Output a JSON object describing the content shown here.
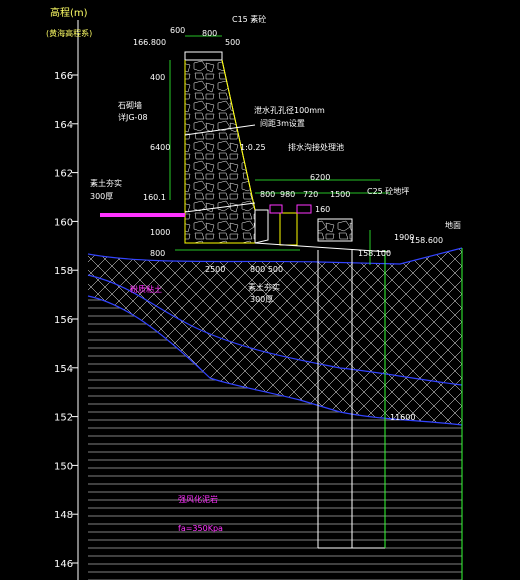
{
  "axis": {
    "title": "高程(m)",
    "subtitle": "(黄海高程系)",
    "ticks": [
      "166",
      "164",
      "162",
      "160",
      "158",
      "156",
      "154",
      "152",
      "150",
      "148",
      "146"
    ]
  },
  "labels": {
    "top_elev": "166.800",
    "c15": "C15 素砼",
    "dim_600": "600",
    "dim_800": "800",
    "dim_500": "500",
    "dim_400": "400",
    "dim_6400": "6400",
    "ret_wall": "石砌墙",
    "ret_wall_sub": "详JG-08",
    "drain": "泄水孔孔径100mm",
    "drain_sub": "间距3m设置",
    "slope": "1:0.25",
    "sewer": "排水沟接处理池",
    "dim_6200": "6200",
    "dim_800b": "800",
    "dim_980": "980",
    "dim_720": "720",
    "dim_1500": "1500",
    "dim_160": "160",
    "c25": "C25 砼地坪",
    "soil_fill": "素土夯实",
    "soil_fill_sub": "300厚",
    "elev_160": "160.1",
    "dim_1000": "1000",
    "dim_800c": "800",
    "elev_158_1": "158.100",
    "elev_158_6": "158.600",
    "dim_1900": "1900",
    "ground": "地面",
    "dim_2500": "2500",
    "dim_800_500": "800 500",
    "soil_fill_2": "素土夯实",
    "soil_fill_2_sub": "300厚",
    "layer_1": "粉质粘土",
    "dim_11600": "11600",
    "rock_layer": "强风化泥岩",
    "bearing": "fa=350Kpa"
  }
}
